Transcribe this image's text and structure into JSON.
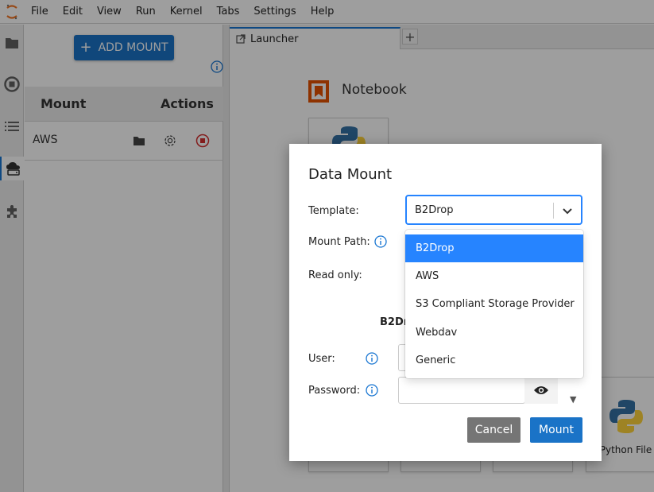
{
  "menubar": {
    "items": [
      "File",
      "Edit",
      "View",
      "Run",
      "Kernel",
      "Tabs",
      "Settings",
      "Help"
    ]
  },
  "activitybar": {
    "icons": [
      "folder-icon",
      "running-icon",
      "toc-icon",
      "data-mount-icon",
      "extension-icon"
    ]
  },
  "sidepanel": {
    "add_mount_label": "ADD MOUNT",
    "table": {
      "headers": [
        "Mount",
        "Actions"
      ],
      "rows": [
        {
          "name": "AWS"
        }
      ]
    }
  },
  "main": {
    "tab_label": "Launcher",
    "tab_add": "+",
    "notebook_section": "Notebook",
    "python_file_label": "Python File"
  },
  "dialog": {
    "title": "Data Mount",
    "template_label": "Template:",
    "template_value": "B2Drop",
    "mount_path_label": "Mount Path:",
    "read_only_label": "Read only:",
    "section_partial": "B2Dro",
    "user_label": "User:",
    "password_label": "Password:",
    "options": [
      "B2Drop",
      "AWS",
      "S3 Compliant Storage Provider",
      "Webdav",
      "Generic"
    ],
    "selected_option": "B2Drop",
    "cancel_label": "Cancel",
    "mount_label": "Mount"
  },
  "colors": {
    "accent": "#1a73c7",
    "select_highlight": "#2684ff",
    "notebook_orange": "#e65100",
    "cancel_gray": "#757575",
    "stop_red": "#d32f2f"
  }
}
